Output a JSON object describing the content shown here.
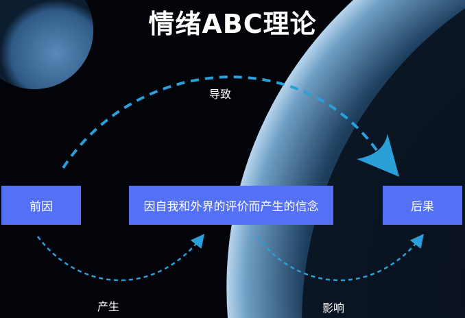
{
  "title": "情绪ABC理论",
  "boxes": {
    "antecedent": "前因",
    "belief": "因自我和外界的评价而产生的信念",
    "consequence": "后果"
  },
  "arrows": {
    "top": "导致",
    "bottom_left": "产生",
    "bottom_right": "影响"
  },
  "colors": {
    "box": "#5470f5",
    "arrow": "#2a9fd8"
  }
}
